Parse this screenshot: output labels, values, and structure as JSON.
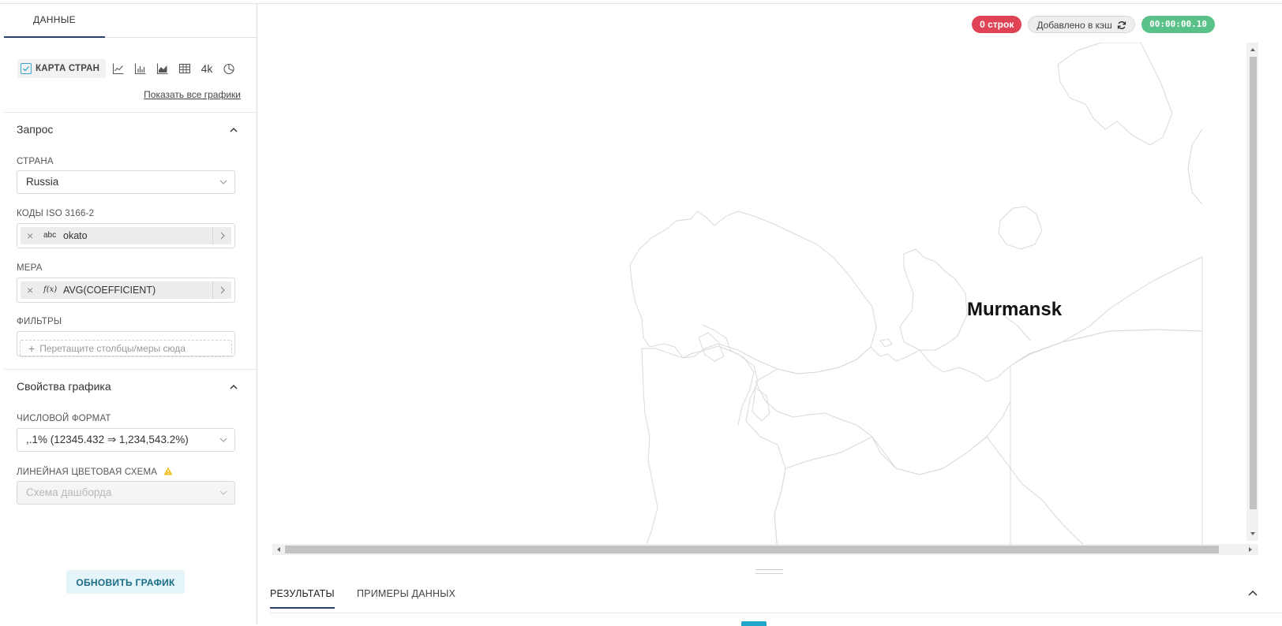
{
  "left_panel": {
    "tab_data": "ДАННЫЕ",
    "viz_type": {
      "selected_label": "КАРТА СТРАН",
      "icons": [
        "line-chart-icon",
        "bar-chart-icon",
        "area-chart-icon",
        "table-icon",
        "big-number-icon",
        "pie-chart-icon"
      ],
      "big_number_label": "4k"
    },
    "show_all_charts": "Показать все графики",
    "query": {
      "title": "Запрос",
      "country_label": "СТРАНА",
      "country_value": "Russia",
      "iso_label": "КОДЫ ISO 3166-2",
      "iso_tag": {
        "type": "abc",
        "name": "okato"
      },
      "measure_label": "МЕРА",
      "measure_tag": {
        "type": "f(x)",
        "name": "AVG(COEFFICIENT)"
      },
      "filters_label": "ФИЛЬТРЫ",
      "filters_placeholder": "Перетащите столбцы/меры сюда"
    },
    "chart_properties": {
      "title": "Свойства графика",
      "number_format_label": "ЧИСЛОВОЙ ФОРМАТ",
      "number_format_value": ",.1% (12345.432 ⇒ 1,234,543.2%)",
      "color_scheme_label": "ЛИНЕЙНАЯ ЦВЕТОВАЯ СХЕМА",
      "color_scheme_placeholder": "Схема дашборда"
    },
    "update_button": "ОБНОВИТЬ ГРАФИК"
  },
  "status": {
    "rows": "0 строк",
    "cache": "Добавлено в кэш",
    "timer": "00:00:00.10",
    "colors": {
      "rows": "#e04355",
      "timer": "#5ac189"
    }
  },
  "map": {
    "region_label": "Murmansk"
  },
  "bottom_tabs": {
    "results": "РЕЗУЛЬТАТЫ",
    "samples": "ПРИМЕРЫ ДАННЫХ"
  }
}
